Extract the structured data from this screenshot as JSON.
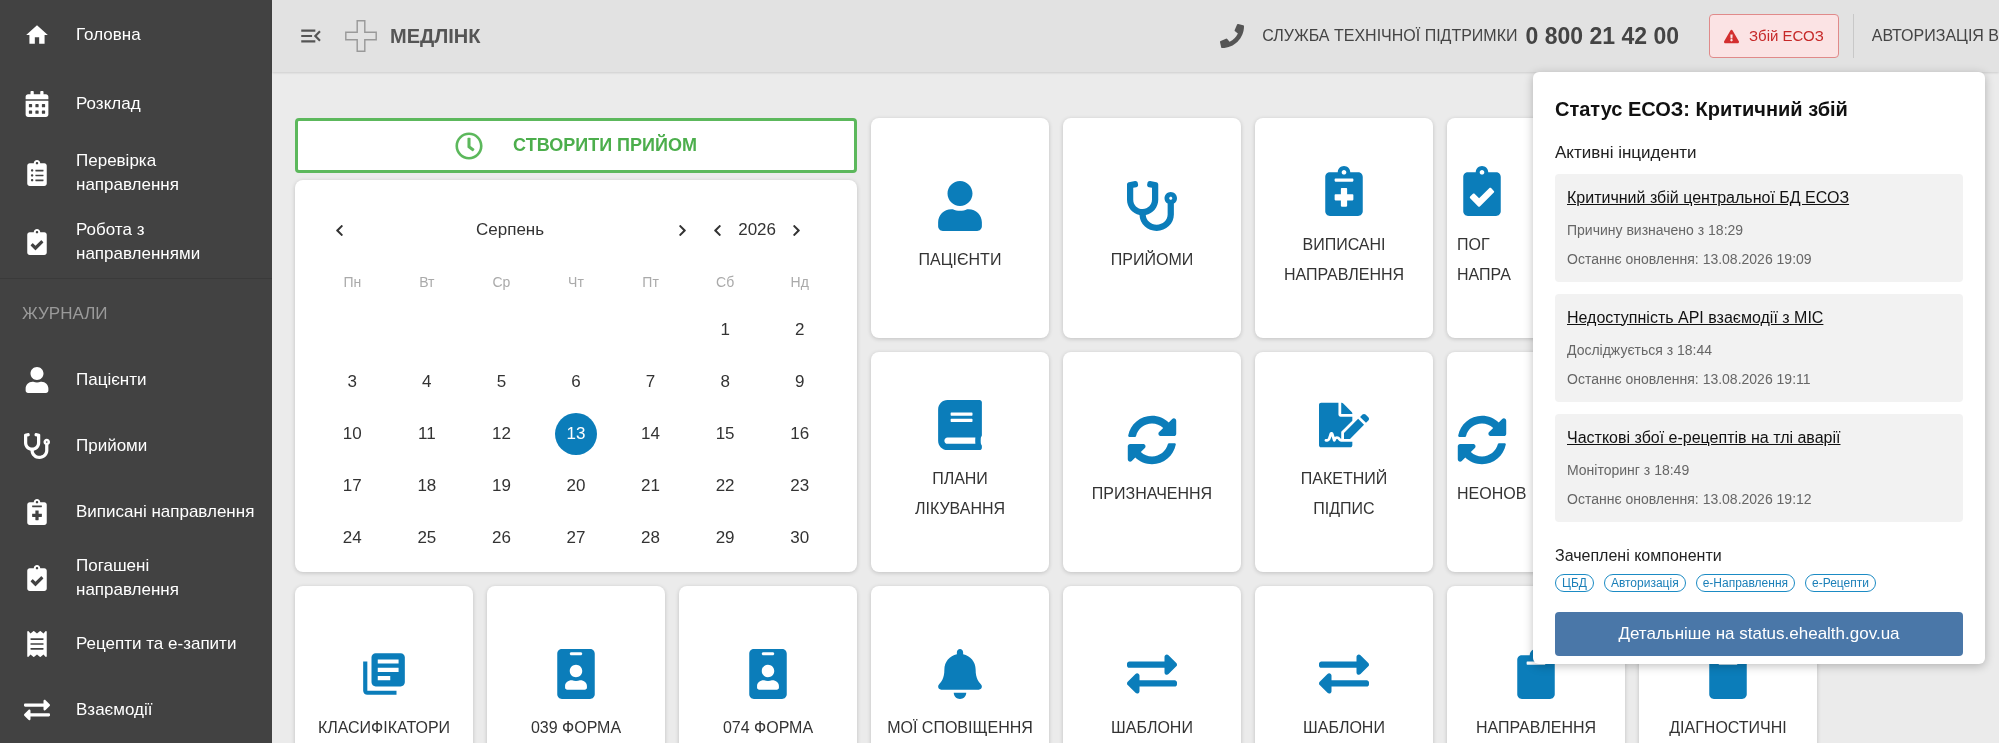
{
  "sidebar": {
    "items": [
      {
        "lines": [
          "Головна"
        ]
      },
      {
        "lines": [
          "Розклад"
        ]
      },
      {
        "lines": [
          "Перевірка",
          "направлення"
        ]
      },
      {
        "lines": [
          "Робота з",
          "направленнями"
        ]
      }
    ],
    "section": "ЖУРНАЛИ",
    "journal_items": [
      {
        "lines": [
          "Пацієнти"
        ]
      },
      {
        "lines": [
          "Прийоми"
        ]
      },
      {
        "lines": [
          "Виписані направлення"
        ]
      },
      {
        "lines": [
          "Погашені",
          "направлення"
        ]
      },
      {
        "lines": [
          "Рецепти та е-запити"
        ]
      },
      {
        "lines": [
          "Взаємодії"
        ]
      }
    ]
  },
  "topbar": {
    "brand": "МЕДЛІНК",
    "support_label": "СЛУЖБА ТЕХНІЧНОЇ ПІДТРИМКИ",
    "phone": "0 800 21 42 00",
    "alert_button": "Збій ЕСОЗ",
    "auth": "АВТОРИЗАЦІЯ В"
  },
  "create_button": "СТВОРИТИ ПРИЙОМ",
  "calendar": {
    "month": "Серпень",
    "year": "2026",
    "weekdays": [
      "Пн",
      "Вт",
      "Ср",
      "Чт",
      "Пт",
      "Сб",
      "Нд"
    ],
    "weeks": [
      [
        {
          "text": "1",
          "selected": false
        },
        {
          "text": "2",
          "selected": false
        }
      ],
      [
        {
          "text": "3",
          "selected": false
        },
        {
          "text": "4",
          "selected": false
        },
        {
          "text": "5",
          "selected": false
        },
        {
          "text": "6",
          "selected": false
        },
        {
          "text": "7",
          "selected": false
        },
        {
          "text": "8",
          "selected": false
        },
        {
          "text": "9",
          "selected": false
        }
      ],
      [
        {
          "text": "10",
          "selected": false
        },
        {
          "text": "11",
          "selected": false
        },
        {
          "text": "12",
          "selected": false
        },
        {
          "text": "13",
          "selected": true
        },
        {
          "text": "14",
          "selected": false
        },
        {
          "text": "15",
          "selected": false
        },
        {
          "text": "16",
          "selected": false
        }
      ],
      [
        {
          "text": "17",
          "selected": false
        },
        {
          "text": "18",
          "selected": false
        },
        {
          "text": "19",
          "selected": false
        },
        {
          "text": "20",
          "selected": false
        },
        {
          "text": "21",
          "selected": false
        },
        {
          "text": "22",
          "selected": false
        },
        {
          "text": "23",
          "selected": false
        }
      ],
      [
        {
          "text": "24",
          "selected": false
        },
        {
          "text": "25",
          "selected": false
        },
        {
          "text": "26",
          "selected": false
        },
        {
          "text": "27",
          "selected": false
        },
        {
          "text": "28",
          "selected": false
        },
        {
          "text": "29",
          "selected": false
        },
        {
          "text": "30",
          "selected": false
        }
      ]
    ]
  },
  "tiles": [
    {
      "lines": [
        "ПАЦІЄНТИ"
      ]
    },
    {
      "lines": [
        "ПРИЙОМИ"
      ]
    },
    {
      "lines": [
        "ВИПИСАНІ",
        "НАПРАВЛЕННЯ"
      ]
    },
    {
      "lines": [
        "ПОГ",
        "НАПРА"
      ]
    },
    {
      "lines": [
        "ПЛАНИ",
        "ЛІКУВАННЯ"
      ]
    },
    {
      "lines": [
        "ПРИЗНАЧЕННЯ"
      ]
    },
    {
      "lines": [
        "ПАКЕТНИЙ",
        "ПІДПИС"
      ]
    },
    {
      "lines": [
        "НЕОНОВ"
      ]
    },
    {
      "lines": [
        "КЛАСИФІКАТОРИ"
      ]
    },
    {
      "lines": [
        "039 ФОРМА"
      ]
    },
    {
      "lines": [
        "074 ФОРМА"
      ]
    },
    {
      "lines": [
        "МОЇ СПОВІЩЕННЯ"
      ]
    },
    {
      "lines": [
        "ШАБЛОНИ"
      ]
    },
    {
      "lines": [
        "ШАБЛОНИ"
      ]
    },
    {
      "lines": [
        "НАПРАВЛЕННЯ"
      ]
    },
    {
      "lines": [
        "ДІАГНОСТИЧНІ"
      ]
    }
  ],
  "status_popup": {
    "title": "Статус ЕСОЗ: Критичний збій",
    "incidents_label": "Активні інциденти",
    "incidents": [
      {
        "title": "Критичний збій центральної БД ЕСОЗ",
        "status": "Причину визначено з 18:29",
        "updated": "Останнє оновлення: 13.08.2026 19:09"
      },
      {
        "title": "Недоступність API взаємодії з МІС",
        "status": "Досліджується з 18:44",
        "updated": "Останнє оновлення: 13.08.2026 19:11"
      },
      {
        "title": "Часткові збої е-рецептів на тлі аварії",
        "status": "Моніторинг з 18:49",
        "updated": "Останнє оновлення: 13.08.2026 19:12"
      }
    ],
    "components_label": "Зачеплені компоненти",
    "components": [
      "ЦБД",
      "Авторизація",
      "е-Направлення",
      "е-Рецепти"
    ],
    "details_button": "Детальніше на status.ehealth.gov.ua"
  }
}
